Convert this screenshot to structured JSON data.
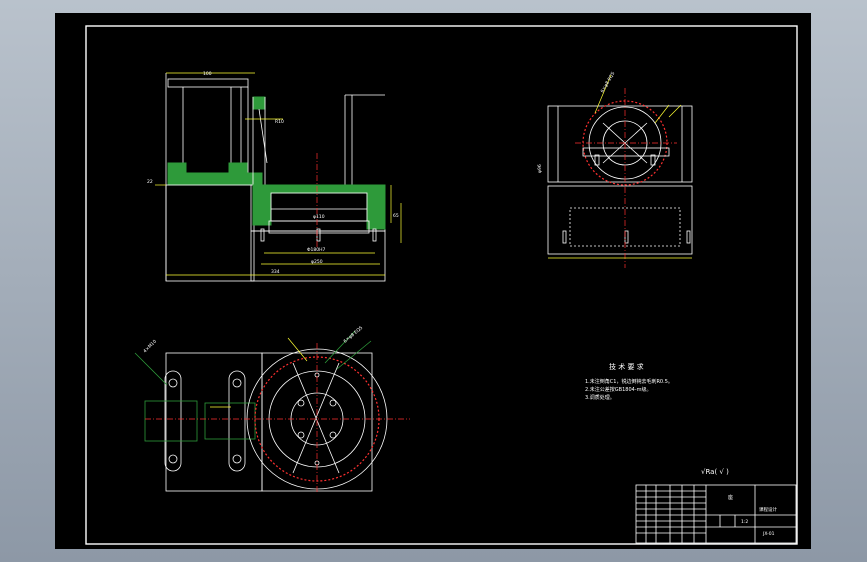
{
  "drawing": {
    "tech_req_title": "技 术 要 求",
    "tech_req_items": [
      "1.未注倒角C1，锐边倒钝去毛刺R0.5。",
      "2.未注公差按GB1804-m级。",
      "3.调质处理。"
    ],
    "roughness_note": "√Ra(   √   )",
    "title_block": {
      "part_name": "座",
      "school": "课程设计",
      "drawing_no": "JX-01",
      "scale": "1:2"
    },
    "dimensions": {
      "bore_label": "φ110",
      "base_width": "φ250",
      "front_width": "Φ180H7",
      "overall_width": "334",
      "height": "100",
      "side_height": "65",
      "left_height": "22",
      "pcd_label": "6×φ8 EQS",
      "tap_label": "4×M10",
      "radius_label": "R10",
      "side_flange": "φ96"
    },
    "colors": {
      "sheet": "#000000",
      "outline": "#ffffff",
      "centerline": "#ff3030",
      "hatch": "#2e9a3a",
      "dimension": "#ffff33",
      "leader": "#2e9a3a"
    }
  }
}
